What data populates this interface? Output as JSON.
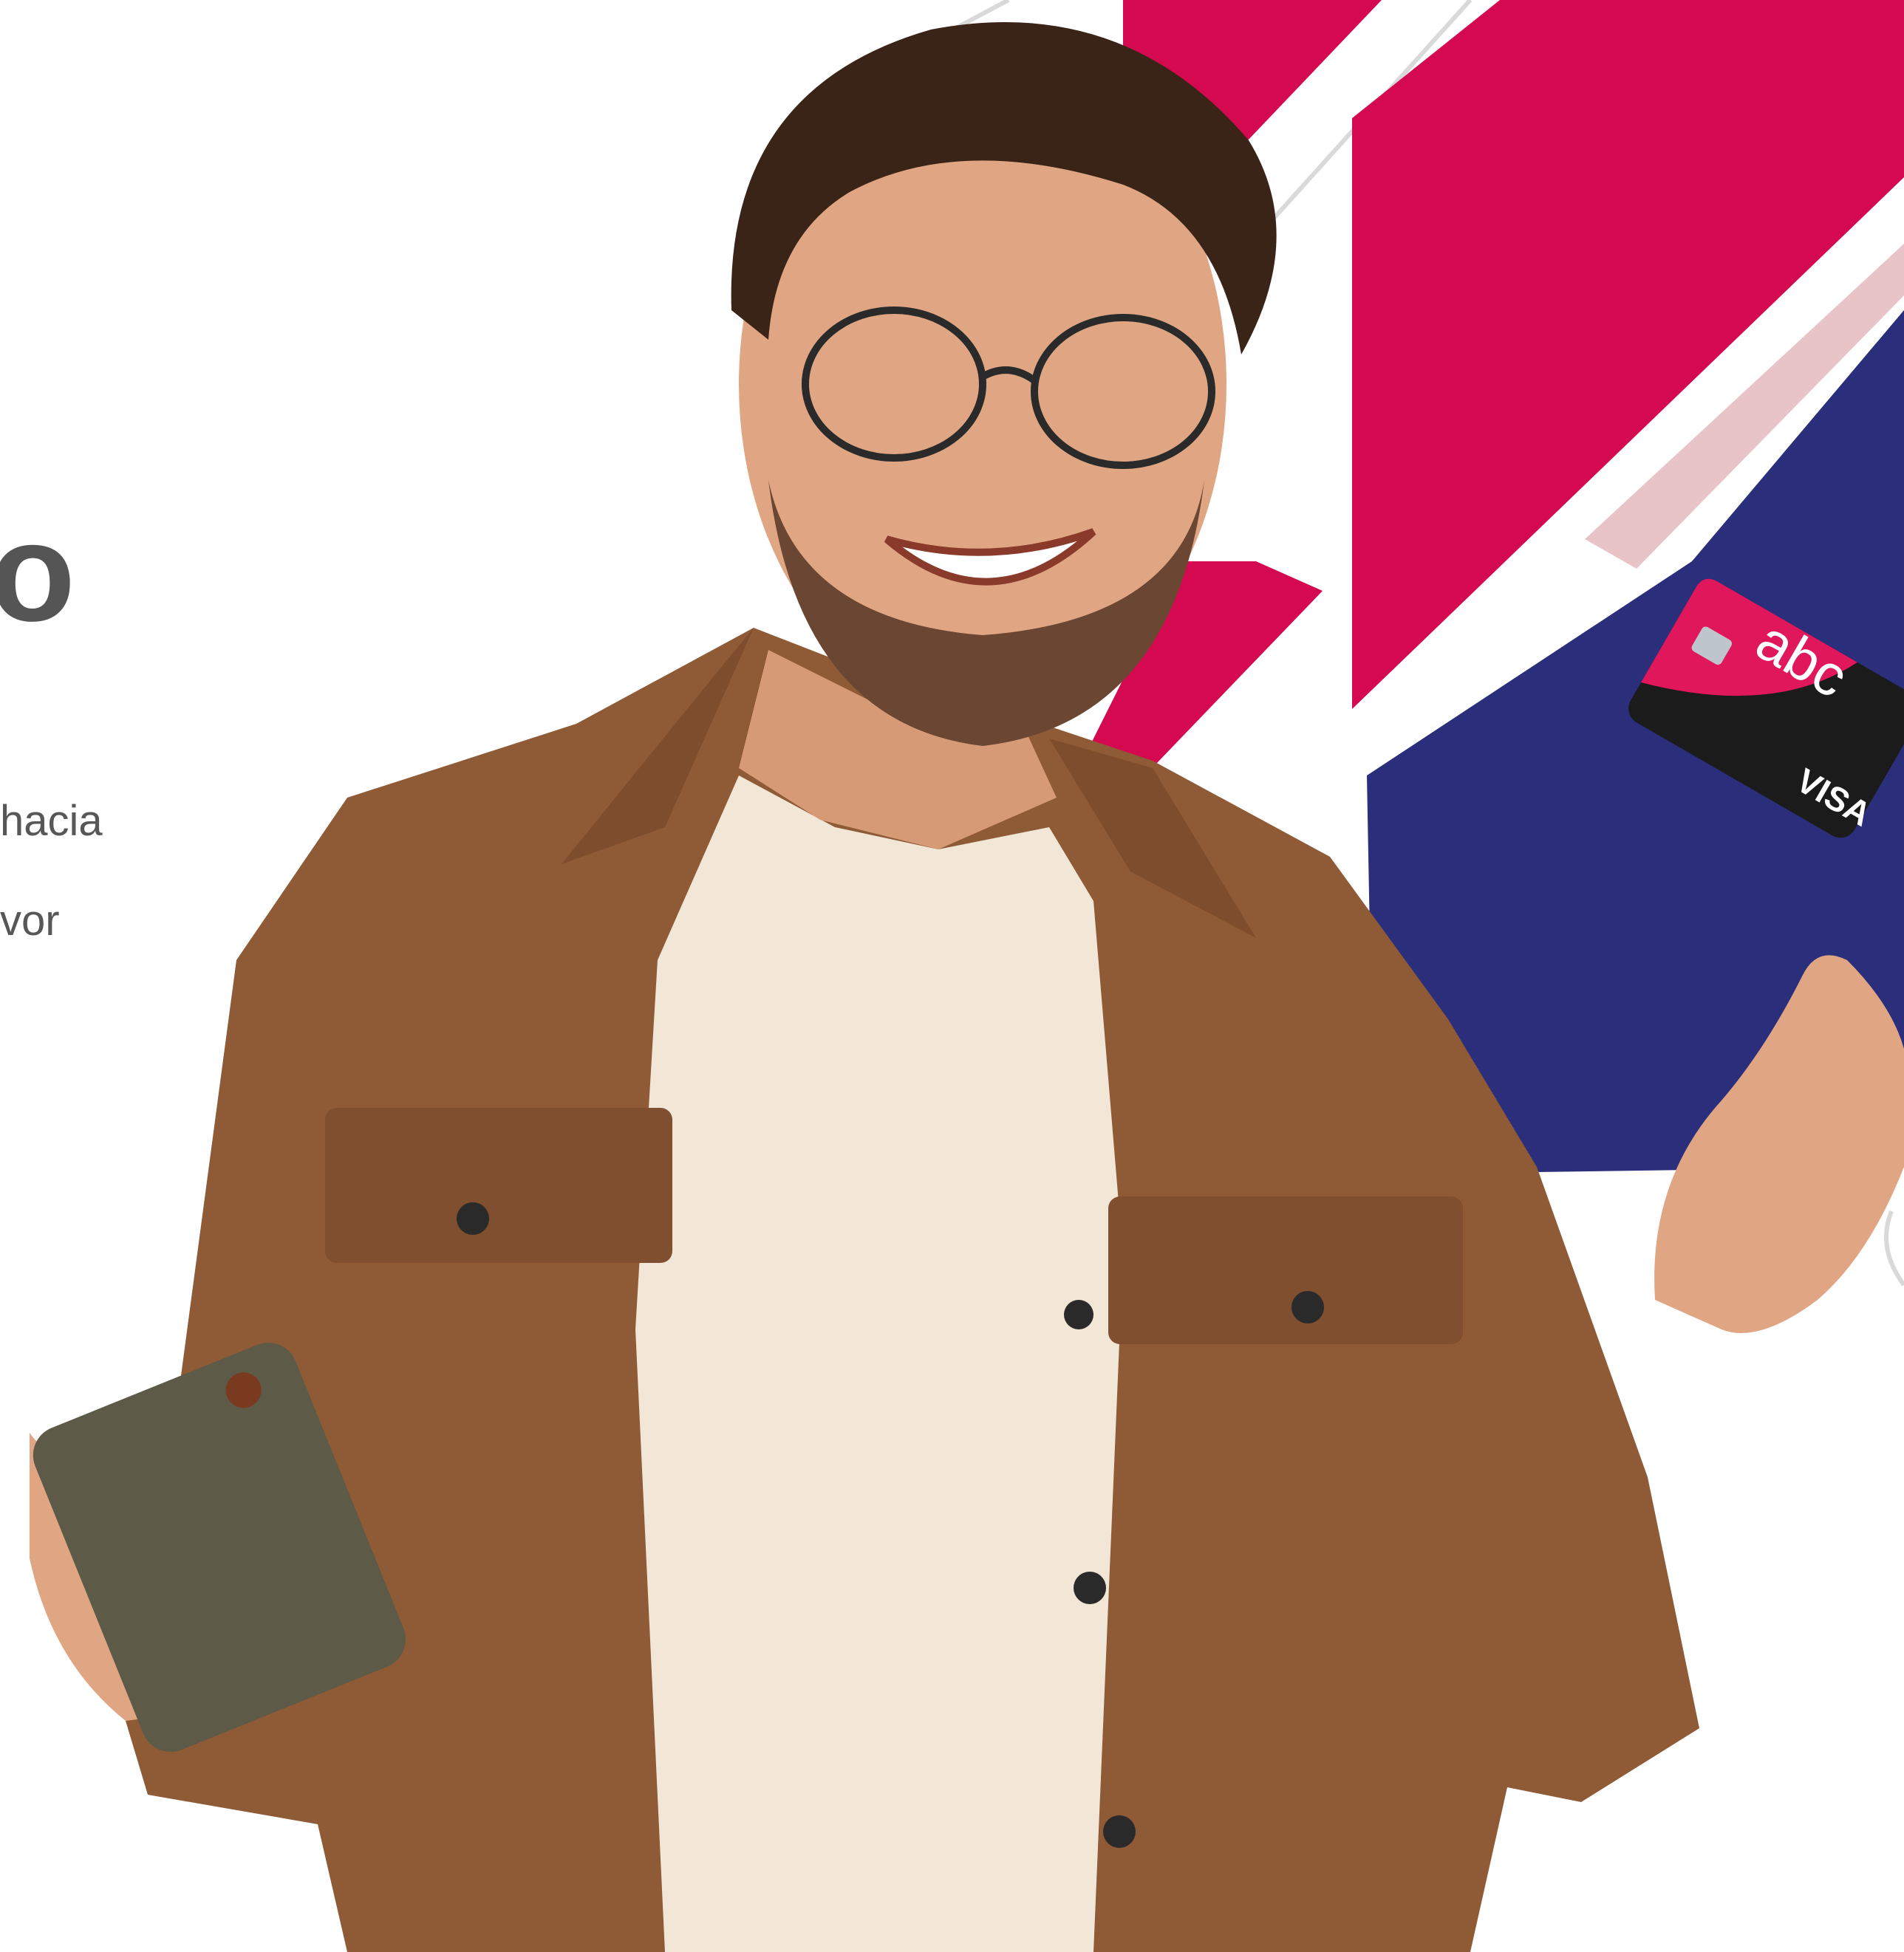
{
  "hero": {
    "heading_fragment": "o",
    "body_fragment_line1": "hacia",
    "body_fragment_line2": "vor"
  },
  "card": {
    "brand": "abc",
    "network": "VISA"
  },
  "colors": {
    "crimson": "#d4094f",
    "navy": "#2a2e7b",
    "pink_light": "#e8c4c8",
    "jacket": "#8f5a36",
    "shirt": "#f2e7d7",
    "skin": "#e0a684",
    "hair": "#3a2418",
    "text_gray": "#575757"
  }
}
